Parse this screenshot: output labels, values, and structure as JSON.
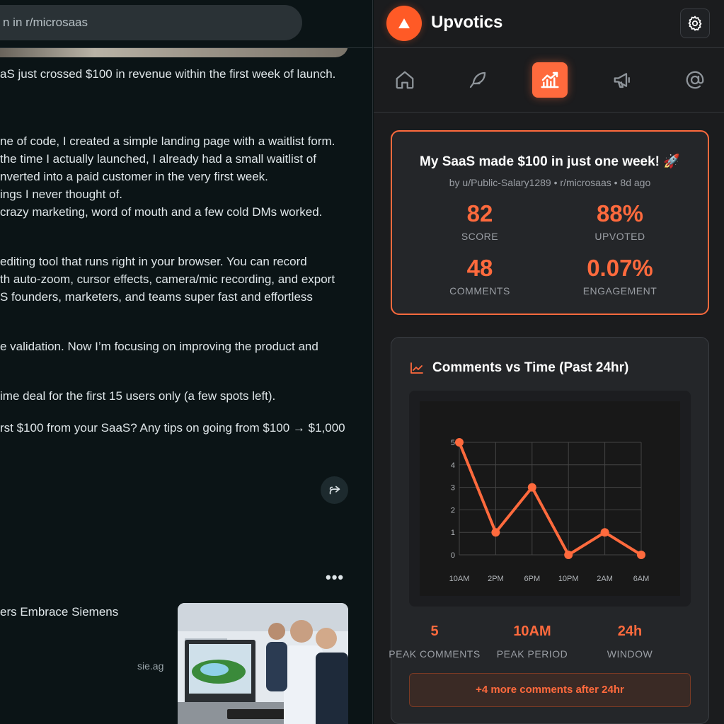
{
  "reddit": {
    "search_text": "n in r/microsaas",
    "post_lines": [
      "aS just crossed $100 in revenue within the first week of launch.",
      "ne of code, I created a simple landing page with a waitlist form.",
      " the time I actually launched, I already had a small waitlist of",
      "nverted into a paid customer in the very first week.",
      "ings I never thought of.",
      "crazy marketing, word of mouth and a few cold DMs worked.",
      "editing tool that runs right in your browser. You can record",
      "th auto-zoom, cursor effects, camera/mic recording, and export",
      "S founders, marketers, and teams super fast and effortless",
      "e validation. Now I’m focusing on improving the product and",
      "ime deal for the first 15 users only (a few spots left).",
      "rst $100 from your SaaS? Any tips on going from $100 → $1,000"
    ],
    "more_options": "•••",
    "ad": {
      "title": "ers Embrace Siemens",
      "source": "sie.ag"
    }
  },
  "panel": {
    "brand": "Upvotics",
    "nav_icons": [
      "home-icon",
      "feather-icon",
      "analytics-icon",
      "megaphone-icon",
      "at-icon"
    ],
    "active_nav": "analytics-icon",
    "accent_color": "#ff6a3d",
    "post": {
      "title": "My SaaS made $100 in just one week! 🚀",
      "meta": "by u/Public-Salary1289 • r/microsaas • 8d ago"
    },
    "stats": [
      {
        "value": "82",
        "label": "SCORE"
      },
      {
        "value": "88%",
        "label": "UPVOTED"
      },
      {
        "value": "48",
        "label": "COMMENTS"
      },
      {
        "value": "0.07%",
        "label": "ENGAGEMENT"
      }
    ],
    "chart_title": "Comments vs Time (Past 24hr)",
    "summary": [
      {
        "value": "5",
        "label": "PEAK COMMENTS"
      },
      {
        "value": "10AM",
        "label": "PEAK PERIOD"
      },
      {
        "value": "24h",
        "label": "WINDOW"
      }
    ],
    "more_button": "+4 more comments after 24hr"
  },
  "chart_data": {
    "type": "line",
    "title": "Comments vs Time (Past 24hr)",
    "categories": [
      "10AM",
      "2PM",
      "6PM",
      "10PM",
      "2AM",
      "6AM"
    ],
    "values": [
      5,
      1,
      3,
      0,
      1,
      0
    ],
    "yticks": [
      "0",
      "1",
      "2",
      "3",
      "4",
      "5"
    ],
    "ylim": [
      0,
      5
    ],
    "grid": true,
    "color": "#ff6a3d"
  }
}
